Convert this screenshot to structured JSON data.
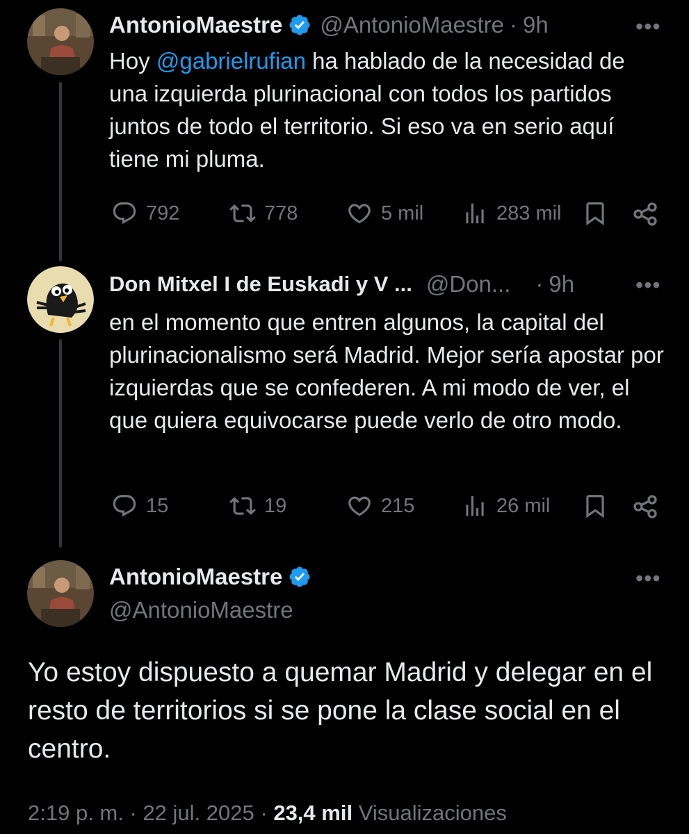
{
  "tweet1": {
    "name": "AntonioMaestre",
    "handle": "@AntonioMaestre",
    "sep": "·",
    "time": "9h",
    "more": "•••",
    "text_pre": "Hoy ",
    "mention": "@gabrielrufian",
    "text_post": " ha hablado de la necesidad de una izquierda plurinacional con todos los partidos juntos de todo el territorio. Si eso va en serio aquí tiene mi pluma.",
    "replies": "792",
    "retweets": "778",
    "likes": "5 mil",
    "views": "283 mil"
  },
  "tweet2": {
    "name": "Don Mitxel I de Euskadi y V ...",
    "handle": "@Don...",
    "sep": "·",
    "time": "9h",
    "more": "•••",
    "text": "en el momento que entren algunos, la capital del plurinacionalismo será Madrid. Mejor sería apostar por izquierdas que se confederen. A mi modo de ver, el que quiera equivocarse puede verlo de otro modo.",
    "replies": "15",
    "retweets": "19",
    "likes": "215",
    "views": "26 mil"
  },
  "tweet3": {
    "name": "AntonioMaestre",
    "handle": "@AntonioMaestre",
    "more": "•••",
    "text": "Yo estoy dispuesto a quemar Madrid y delegar en el resto de territorios si se pone la clase social en el centro.",
    "time": "2:19 p. m.",
    "sep1": "·",
    "date": "22 jul. 2025",
    "sep2": "·",
    "views_count": "23,4 mil",
    "views_label": "Visualizaciones"
  },
  "colors": {
    "background": "#000000",
    "text": "#e7e9ea",
    "secondary": "#71767b",
    "accent": "#1d9bf0",
    "thread_line": "#333639"
  },
  "icons": {
    "reply": "reply-icon",
    "retweet": "retweet-icon",
    "like": "heart-icon",
    "views": "views-icon",
    "bookmark": "bookmark-icon",
    "share": "share-icon",
    "verified": "verified-badge-icon"
  }
}
